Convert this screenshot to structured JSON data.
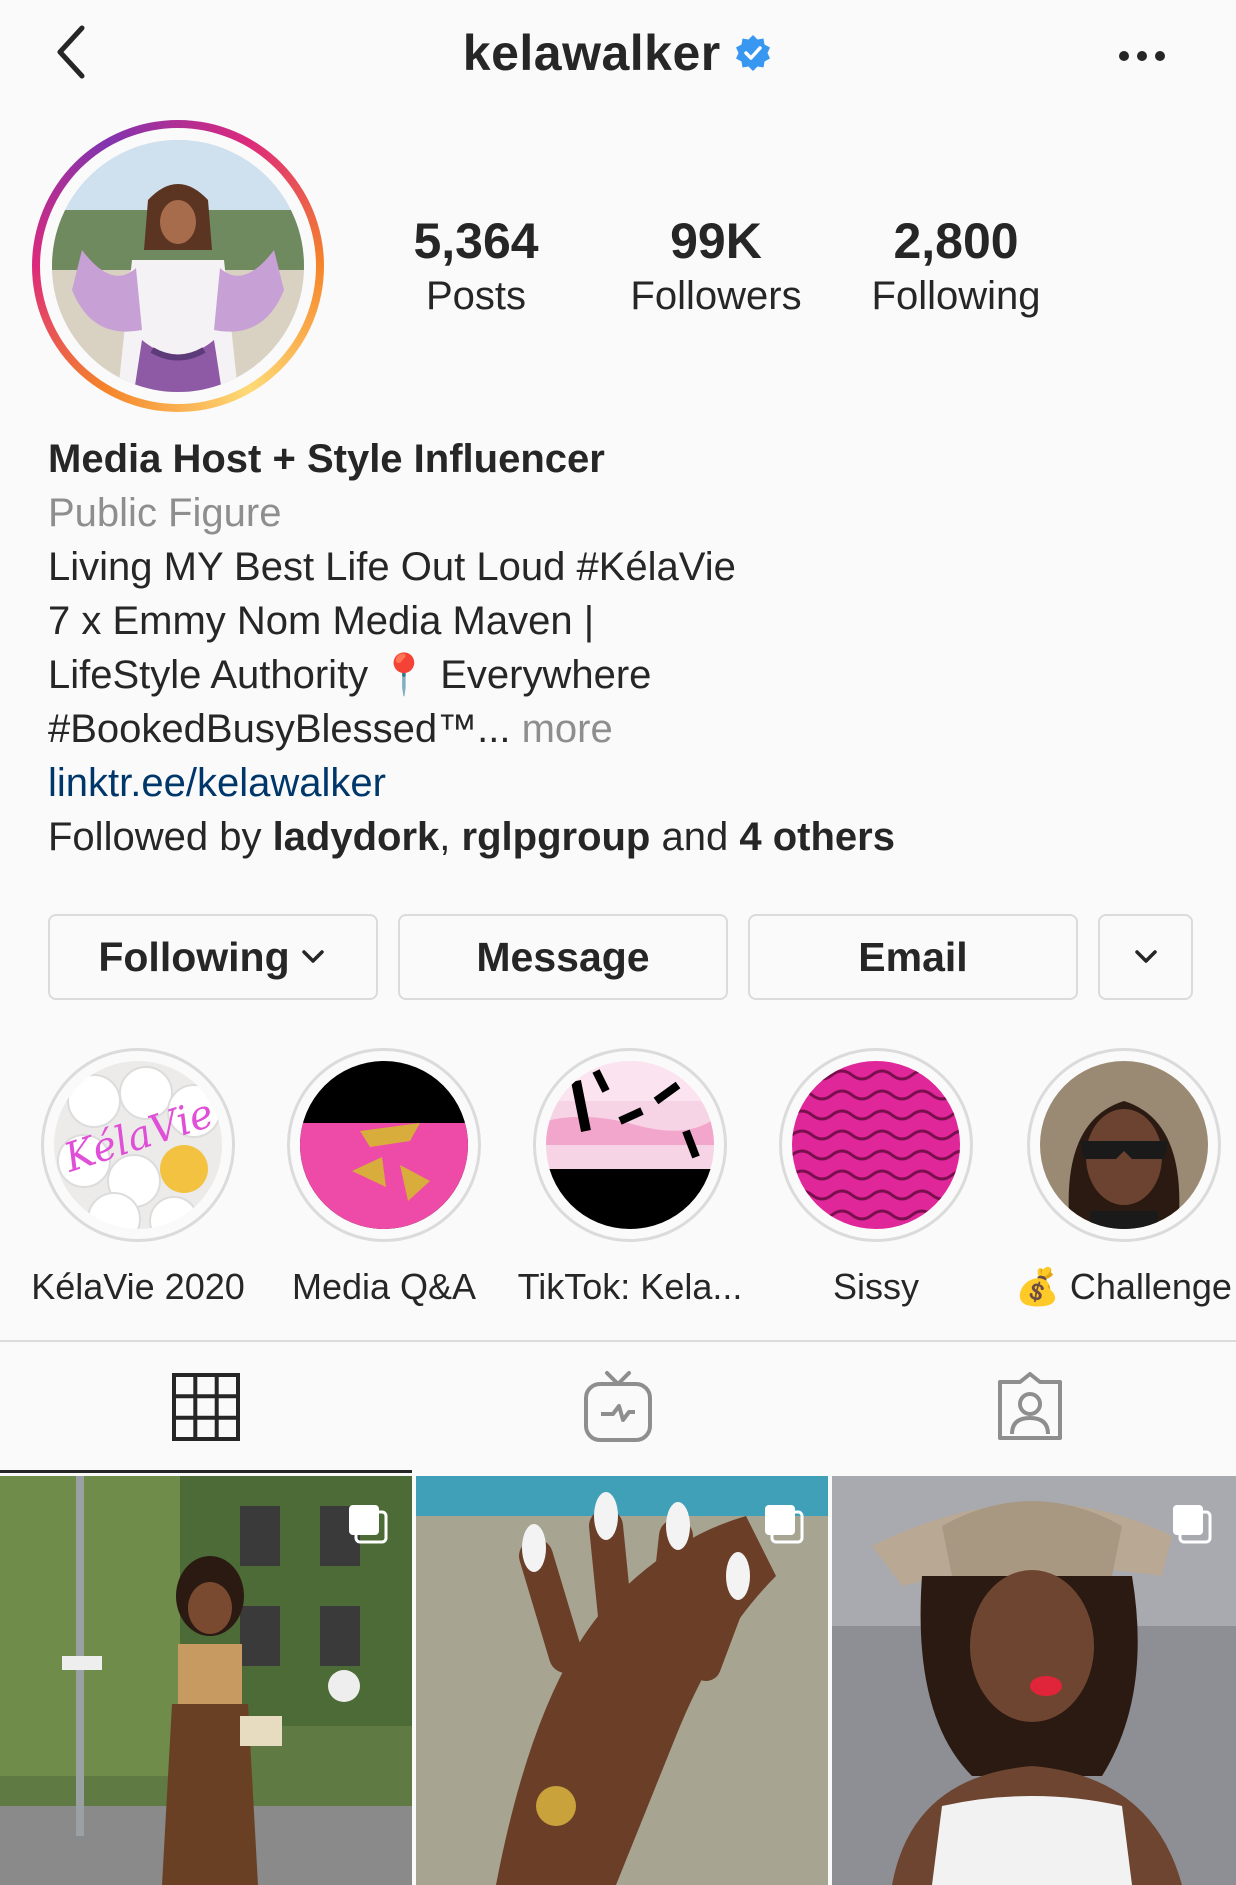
{
  "header": {
    "username": "kelawalker",
    "back_icon": "chevron-left-icon",
    "verified_icon": "verified-badge-icon",
    "more_icon": "ellipsis-icon"
  },
  "stats": {
    "posts": {
      "value": "5,364",
      "label": "Posts"
    },
    "followers": {
      "value": "99K",
      "label": "Followers"
    },
    "following": {
      "value": "2,800",
      "label": "Following"
    }
  },
  "bio": {
    "name": "Media Host + Style Influencer",
    "category": "Public Figure",
    "line1": "Living MY Best Life Out Loud #KélaVie",
    "line2": "7 x Emmy Nom Media Maven |",
    "line3_a": "LifeStyle Authority ",
    "line3_pin": "📍",
    "line3_b": " Everywhere",
    "line4": "#BookedBusyBlessed™...",
    "more": " more",
    "link": "linktr.ee/kelawalker",
    "followed_by_prefix": "Followed by ",
    "followed_user1": "ladydork",
    "followed_sep": ", ",
    "followed_user2": "rglpgroup",
    "followed_and": " and ",
    "followed_others": "4 others"
  },
  "actions": {
    "following": "Following",
    "message": "Message",
    "email": "Email"
  },
  "highlights": [
    {
      "label": "KélaVie 2020"
    },
    {
      "label": "Media Q&A"
    },
    {
      "label": "TikTok: Kela..."
    },
    {
      "label": "Sissy"
    },
    {
      "label": "💰 Challenge"
    }
  ],
  "highlight_overlay_text": "KélaVie",
  "tabs": [
    {
      "icon": "grid-icon"
    },
    {
      "icon": "igtv-icon"
    },
    {
      "icon": "tagged-icon"
    }
  ],
  "colors": {
    "text": "#262626",
    "secondary": "#8e8e8e",
    "link": "#00376b",
    "verified": "#3897f0",
    "border": "#dbdbdb",
    "background": "#fafafa"
  }
}
